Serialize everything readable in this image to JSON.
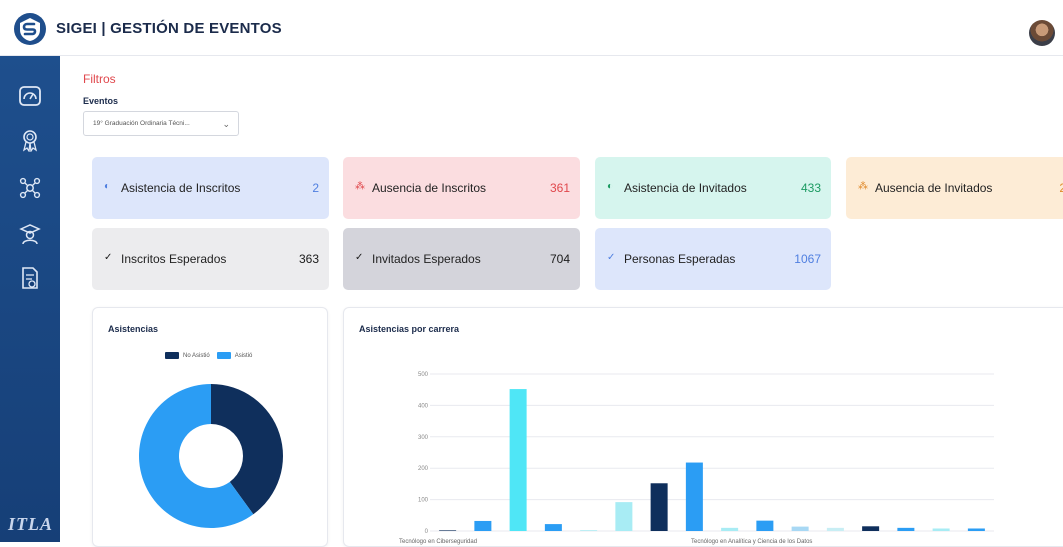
{
  "header": {
    "title": "SIGEI | GESTIÓN DE EVENTOS"
  },
  "sidebar": {
    "items": [
      {
        "icon": "dashboard-icon"
      },
      {
        "icon": "award-icon"
      },
      {
        "icon": "network-icon"
      },
      {
        "icon": "graduate-icon"
      },
      {
        "icon": "report-icon"
      }
    ],
    "footer_logo": "ITLA"
  },
  "filters": {
    "title": "Filtros",
    "events_label": "Eventos",
    "event_selected": "19° Graduación Ordinaria Técni..."
  },
  "cards": [
    {
      "label": "Asistencia de Inscritos",
      "value": "2",
      "bg": "#dde6fb",
      "accent": "#4f7fe0"
    },
    {
      "label": "Ausencia de Inscritos",
      "value": "361",
      "bg": "#fbdde0",
      "accent": "#e0474c"
    },
    {
      "label": "Asistencia de Invitados",
      "value": "433",
      "bg": "#d6f5ee",
      "accent": "#1c9b62"
    },
    {
      "label": "Ausencia de Invitados",
      "value": "2",
      "bg": "#fdecd6",
      "accent": "#e08a2b"
    },
    {
      "label": "Inscritos Esperados",
      "value": "363",
      "bg": "#ececee",
      "accent": "#1b1b1b"
    },
    {
      "label": "Invitados Esperados",
      "value": "704",
      "bg": "#d4d4db",
      "accent": "#1b1b1b"
    },
    {
      "label": "Personas Esperadas",
      "value": "1067",
      "bg": "#dde6fb",
      "accent": "#4f7fe0"
    }
  ],
  "colors": {
    "brand": "#1e4f8d",
    "no_asistio": "#0f2f5c",
    "asistio": "#2b9df4",
    "cyan": "#4fe6f6"
  },
  "chart_data": [
    {
      "type": "pie",
      "title": "Asistencias",
      "labels": [
        "No Asistió",
        "Asistió"
      ],
      "values": [
        40,
        60
      ],
      "colors": [
        "#0f2f5c",
        "#2b9df4"
      ],
      "legend": "top"
    },
    {
      "type": "bar",
      "title": "Asistencias por carrera",
      "ylim": [
        0,
        500
      ],
      "yticks": [
        "0",
        "100",
        "200",
        "300",
        "400",
        "500"
      ],
      "xtick_labels": [
        "Tecnólogo en Ciberseguridad",
        "Tecnólogo en Analítica y Ciencia de los Datos"
      ],
      "values": [
        2,
        32,
        452,
        22,
        3,
        92,
        152,
        218,
        10,
        33,
        14,
        10,
        15,
        10,
        8,
        8
      ],
      "colors": [
        "#0f2f5c",
        "#2b9df4",
        "#4fe6f6",
        "#2b9df4",
        "#b9edf4",
        "#a8ecf4",
        "#0f2f5c",
        "#2b9df4",
        "#a8ecf4",
        "#2b9df4",
        "#a8d8f4",
        "#c8eef4",
        "#0f2f5c",
        "#2b9df4",
        "#a8ecf4",
        "#2b9df4"
      ],
      "grid": true
    }
  ]
}
